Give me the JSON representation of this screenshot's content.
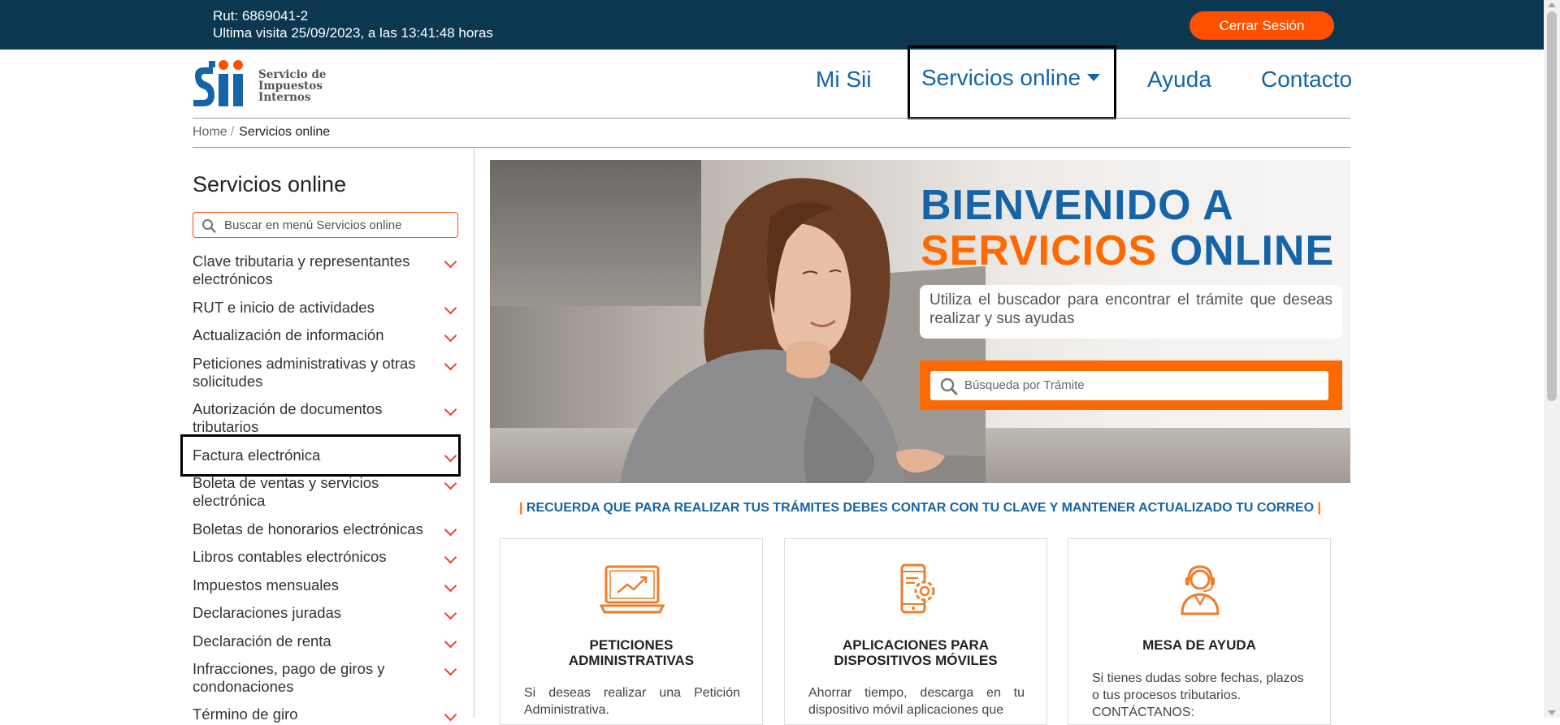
{
  "topbar": {
    "rut": "Rut: 6869041-2",
    "last_visit": "Ultima visita 25/09/2023, a las 13:41:48 horas",
    "logout_label": "Cerrar Sesión"
  },
  "logo": {
    "mark": "sii",
    "line1": "Servicio de",
    "line2": "Impuestos",
    "line3": "Internos"
  },
  "nav": {
    "items": [
      {
        "label": "Mi Sii"
      },
      {
        "label": "Servicios online"
      },
      {
        "label": "Ayuda"
      },
      {
        "label": "Contacto"
      }
    ]
  },
  "breadcrumb": {
    "home": "Home",
    "separator": "/",
    "current": "Servicios online"
  },
  "sidebar": {
    "title": "Servicios online",
    "search_placeholder": "Buscar en menú Servicios online",
    "items": [
      {
        "label": "Clave tributaria y representantes electrónicos"
      },
      {
        "label": "RUT e inicio de actividades"
      },
      {
        "label": "Actualización de información"
      },
      {
        "label": "Peticiones administrativas y otras solicitudes"
      },
      {
        "label": "Autorización de documentos tributarios"
      },
      {
        "label": "Factura electrónica"
      },
      {
        "label": "Boleta de ventas y servicios electrónica"
      },
      {
        "label": "Boletas de honorarios electrónicas"
      },
      {
        "label": "Libros contables electrónicos"
      },
      {
        "label": "Impuestos mensuales"
      },
      {
        "label": "Declaraciones juradas"
      },
      {
        "label": "Declaración de renta"
      },
      {
        "label": "Infracciones, pago de giros y condonaciones"
      },
      {
        "label": "Término de giro"
      }
    ]
  },
  "hero": {
    "title_line1": "BIENVENIDO A",
    "title_line2_orange": "SERVICIOS",
    "title_line2_blue": "ONLINE",
    "description": "Utiliza el buscador para encontrar el trámite que deseas realizar y sus ayudas",
    "search_placeholder": "Búsqueda por Trámite"
  },
  "notice": {
    "bar_left": "|",
    "text": "RECUERDA QUE PARA REALIZAR TUS TRÁMITES DEBES CONTAR CON TU CLAVE Y MANTENER ACTUALIZADO TU CORREO",
    "bar_right": "|"
  },
  "cards": [
    {
      "icon": "laptop-chart-icon",
      "title_line1": "PETICIONES",
      "title_line2": "ADMINISTRATIVAS",
      "body": "Si deseas realizar una Petición Administrativa."
    },
    {
      "icon": "mobile-gear-icon",
      "title_line1": "APLICACIONES PARA",
      "title_line2": "DISPOSITIVOS MÓVILES",
      "body": "Ahorrar tiempo, descarga en tu dispositivo móvil aplicaciones que"
    },
    {
      "icon": "headset-agent-icon",
      "title_line1": "MESA DE AYUDA",
      "title_line2": "",
      "body_line1": "Si tienes dudas sobre fechas, plazos o tus procesos tributarios.",
      "body_line2": "CONTÁCTANOS:"
    }
  ],
  "colors": {
    "topbar_bg": "#0b3850",
    "brand_blue": "#1564a8",
    "brand_orange": "#ff6a00",
    "chevron_red": "#e8422c"
  }
}
